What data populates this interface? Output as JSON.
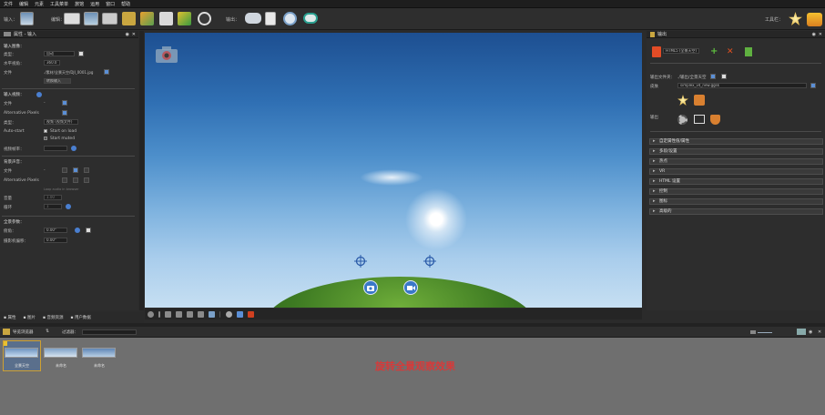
{
  "menu": [
    "文件",
    "编辑",
    "元素",
    "工具菜单",
    "旅馆",
    "运用",
    "窗口",
    "帮助"
  ],
  "toolbar": {
    "input_label": "输入：",
    "edit_label": "编辑：",
    "output_label": "输出：",
    "tools_label": "工具栏：",
    "accent": "#f0a020"
  },
  "left_panel": {
    "title": "属性 - 输入",
    "input_image_section": "输入图像：",
    "type_label": "类型：",
    "type_value": "自动",
    "format_label": "水平视角：",
    "format_value": "360.0",
    "file_label": "文件",
    "file_value": "./素材/全景天空/DJI_0001.jpg",
    "convert_button": "转换输入",
    "input_sequence_section": "输入视频：",
    "seq_file_label": "文件",
    "seq_file_value": "-",
    "alt_pixels_label": "Alternative Pixels",
    "seq_type_label": "类型：",
    "seq_type_value": "视频 (视频文件)",
    "autostart_label": "Auto-start",
    "start_on_load": "Start on load",
    "start_muted": "Start muted",
    "fps_label": "视频帧率：",
    "bg_section": "背景声音：",
    "bg_file_label": "文件",
    "bg_alt_label": "Alternative Pixels",
    "bg_loop_hint": "Loop audio in browser",
    "bg_vol_label": "音量",
    "bg_vol_value": "1.00",
    "bg_loop_label": "循环",
    "bg_loop_value": "1",
    "params_section": "全景参数：",
    "tilt_label": "俯角：",
    "tilt_value": "0.00°",
    "yaw_label": "摄影机偏移：",
    "yaw_value": "0.00°"
  },
  "right_panel": {
    "title": "输出",
    "output_format": "HTML5",
    "output_dropdown": "HTML5 (全景天空)",
    "output_file_label": "输出文件夹：",
    "output_file_value": "./输出/全景天空",
    "template_label": "皮肤",
    "template_value": "simplex_v4_new.ggsk",
    "output_section_label": "输出",
    "accordion": [
      "自定属性值/属性",
      "多段/设置",
      "热点",
      "VR",
      "HTML 设置",
      "控制",
      "图标",
      "高级的"
    ]
  },
  "bottom_tabs": [
    "属性",
    "图片",
    "音频资源",
    "用户数据"
  ],
  "tour": {
    "label": "导览浏览器",
    "filter_label": "过滤器：",
    "thumbs": [
      "全景天空",
      "未命名",
      "未命名"
    ],
    "annotation": "旋转全景观察效果",
    "annotation_color": "#d63a3a"
  }
}
